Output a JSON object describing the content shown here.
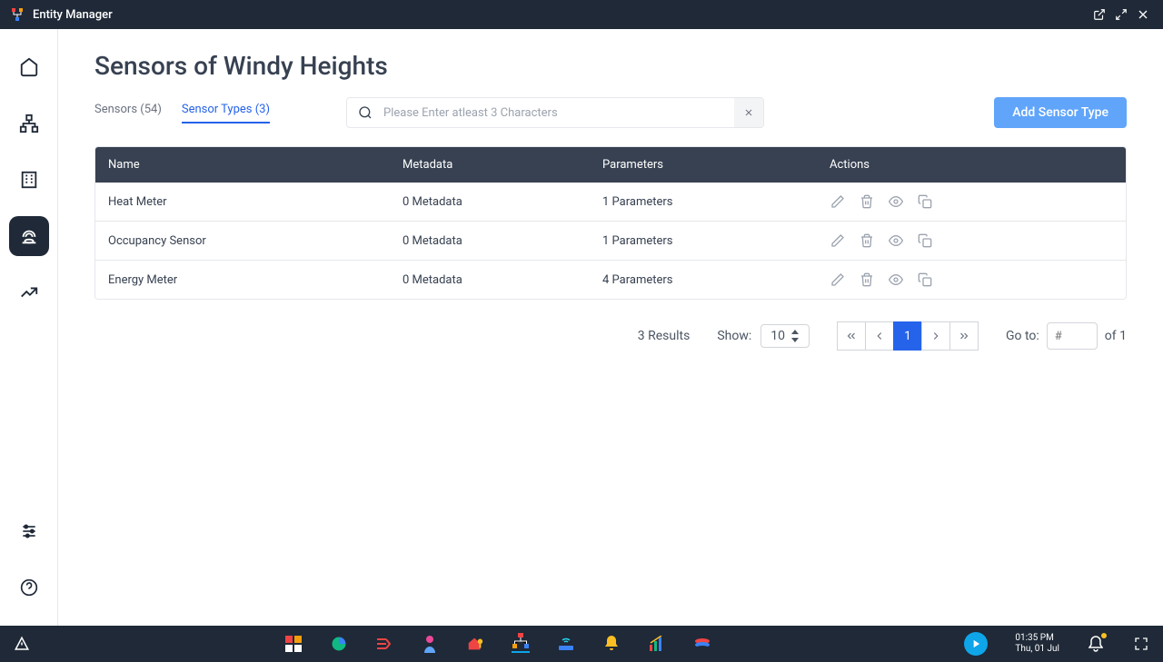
{
  "app": {
    "title": "Entity Manager"
  },
  "page": {
    "title": "Sensors of Windy Heights"
  },
  "tabs": {
    "sensors": "Sensors (54)",
    "sensor_types": "Sensor Types (3)"
  },
  "search": {
    "placeholder": "Please Enter atleast 3 Characters"
  },
  "buttons": {
    "add": "Add Sensor Type"
  },
  "table": {
    "headers": {
      "name": "Name",
      "metadata": "Metadata",
      "parameters": "Parameters",
      "actions": "Actions"
    },
    "rows": [
      {
        "name": "Heat Meter",
        "metadata": "0 Metadata",
        "parameters": "1 Parameters"
      },
      {
        "name": "Occupancy Sensor",
        "metadata": "0 Metadata",
        "parameters": "1 Parameters"
      },
      {
        "name": "Energy Meter",
        "metadata": "0 Metadata",
        "parameters": "4 Parameters"
      }
    ]
  },
  "pagination": {
    "results": "3 Results",
    "show_label": "Show:",
    "show_value": "10",
    "current": "1",
    "goto_label": "Go to:",
    "goto_placeholder": "#",
    "total_text": "of 1"
  },
  "clock": {
    "time": "01:35 PM",
    "date": "Thu, 01 Jul"
  }
}
